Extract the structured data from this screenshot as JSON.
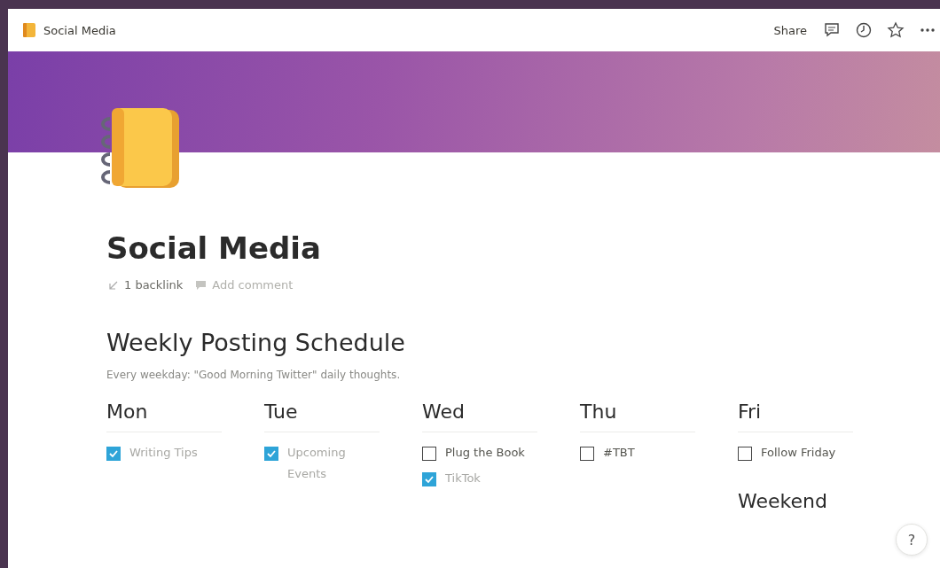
{
  "topbar": {
    "title": "Social Media",
    "share": "Share"
  },
  "page": {
    "title": "Social Media",
    "backlinks": "1 backlink",
    "add_comment": "Add comment"
  },
  "section": {
    "heading": "Weekly Posting Schedule",
    "note": "Every weekday: \"Good Morning Twitter\" daily thoughts."
  },
  "days": [
    {
      "name": "Mon",
      "tasks": [
        {
          "label": "Writing Tips",
          "checked": true
        }
      ]
    },
    {
      "name": "Tue",
      "tasks": [
        {
          "label": "Upcoming Events",
          "checked": true
        }
      ]
    },
    {
      "name": "Wed",
      "tasks": [
        {
          "label": "Plug the Book",
          "checked": false
        },
        {
          "label": "TikTok",
          "checked": true
        }
      ]
    },
    {
      "name": "Thu",
      "tasks": [
        {
          "label": "#TBT",
          "checked": false
        }
      ]
    },
    {
      "name": "Fri",
      "tasks": [
        {
          "label": "Follow Friday",
          "checked": false
        }
      ],
      "sub_heading": "Weekend"
    }
  ],
  "help": "?"
}
